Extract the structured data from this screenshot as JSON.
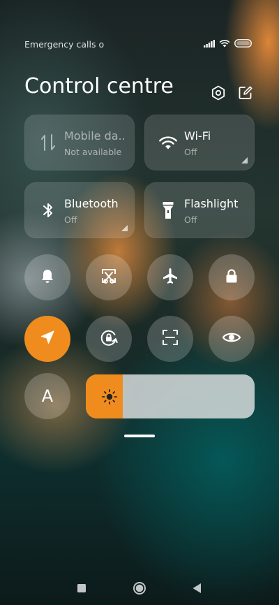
{
  "status_bar": {
    "carrier_text": "Emergency calls o",
    "icons": [
      "signal-icon",
      "wifi-icon",
      "battery-icon"
    ]
  },
  "header": {
    "title": "Control centre",
    "icons": [
      "settings-icon",
      "edit-icon"
    ]
  },
  "tiles": [
    {
      "label": "Mobile da..",
      "status": "Not available",
      "icon": "mobile-data-icon"
    },
    {
      "label": "Wi-Fi",
      "status": "Off",
      "icon": "wifi-icon"
    },
    {
      "label": "Bluetooth",
      "status": "Off",
      "icon": "bluetooth-icon"
    },
    {
      "label": "Flashlight",
      "status": "Off",
      "icon": "flashlight-icon"
    }
  ],
  "toggles_row1": [
    "bell-icon",
    "screenshot-icon",
    "airplane-icon",
    "lock-icon"
  ],
  "toggles_row2": [
    "location-icon",
    "rotation-lock-icon",
    "scan-icon",
    "eye-icon"
  ],
  "auto_brightness": {
    "label": "A"
  },
  "brightness": {
    "level": 0.22,
    "icon": "sun-icon"
  },
  "colors": {
    "accent": "#f08c1e"
  },
  "nav_bar": [
    "recents-icon",
    "home-icon",
    "back-icon"
  ]
}
